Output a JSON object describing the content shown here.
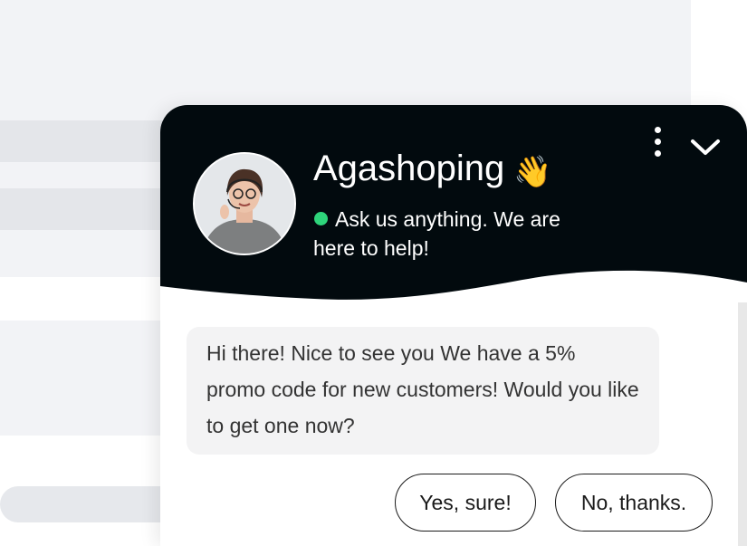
{
  "chat": {
    "title": "Agashoping",
    "title_emoji": "👋",
    "status_text": "Ask us anything. We are here to help!",
    "status_color": "#2ed47a",
    "header_color": "#020a0e",
    "avatar_icon": "support-agent-avatar",
    "menu_icon": "kebab-menu-icon",
    "collapse_icon": "chevron-down-icon",
    "message": "Hi there! Nice to see you We have a 5% promo code for new customers! Would you like to get one now?",
    "quick_replies": [
      "Yes, sure!",
      "No, thanks."
    ]
  }
}
